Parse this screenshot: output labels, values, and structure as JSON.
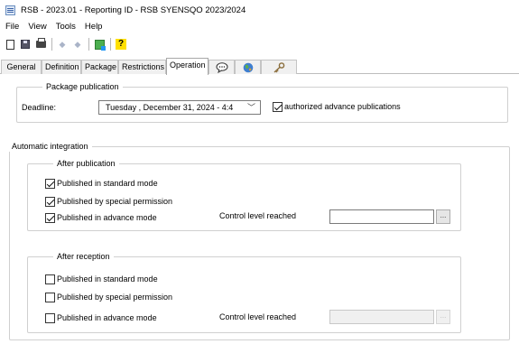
{
  "window": {
    "title": "RSB - 2023.01 - Reporting ID - RSB SYENSQO 2023/2024"
  },
  "menu": [
    "File",
    "View",
    "Tools",
    "Help"
  ],
  "toolbar": {
    "buttons": [
      {
        "icon": "new-document-icon"
      },
      {
        "icon": "save-icon"
      },
      {
        "icon": "print-icon"
      },
      {
        "icon": "back-arrow-icon"
      },
      {
        "icon": "forward-arrow-icon"
      },
      {
        "icon": "publish-icon"
      },
      {
        "icon": "help-icon"
      }
    ],
    "help_glyph": "?"
  },
  "tabs": [
    {
      "label": "General"
    },
    {
      "label": "Definition"
    },
    {
      "label": "Package"
    },
    {
      "label": "Restrictions"
    },
    {
      "label": "Operation",
      "active": true
    },
    {
      "icon": "comment-bubble-icon"
    },
    {
      "icon": "globe-icon"
    },
    {
      "icon": "key-icon"
    }
  ],
  "package_publication": {
    "title": "Package publication",
    "deadline_label": "Deadline:",
    "deadline_value": "Tuesday   ,  December  31, 2024 -  4:4",
    "authorized_label": "authorized advance publications",
    "authorized_checked": true
  },
  "automatic_integration": {
    "title": "Automatic integration",
    "after_publication": {
      "title": "After publication",
      "options": [
        {
          "label": "Published in standard mode",
          "checked": true
        },
        {
          "label": "Published by special permission",
          "checked": true
        },
        {
          "label": "Published in advance mode",
          "checked": true
        }
      ],
      "control_level_label": "Control level reached",
      "control_level_value": "",
      "browse_label": "...",
      "enabled": true
    },
    "after_reception": {
      "title": "After reception",
      "options": [
        {
          "label": "Published in standard mode",
          "checked": false
        },
        {
          "label": "Published by special permission",
          "checked": false
        },
        {
          "label": "Published in advance mode",
          "checked": false
        }
      ],
      "control_level_label": "Control level reached",
      "control_level_value": "",
      "browse_label": "...",
      "enabled": false
    }
  },
  "colors": {
    "active_tab": "#ffffff",
    "tab_bg": "#f0f0f0",
    "border": "#d0d0d0"
  }
}
